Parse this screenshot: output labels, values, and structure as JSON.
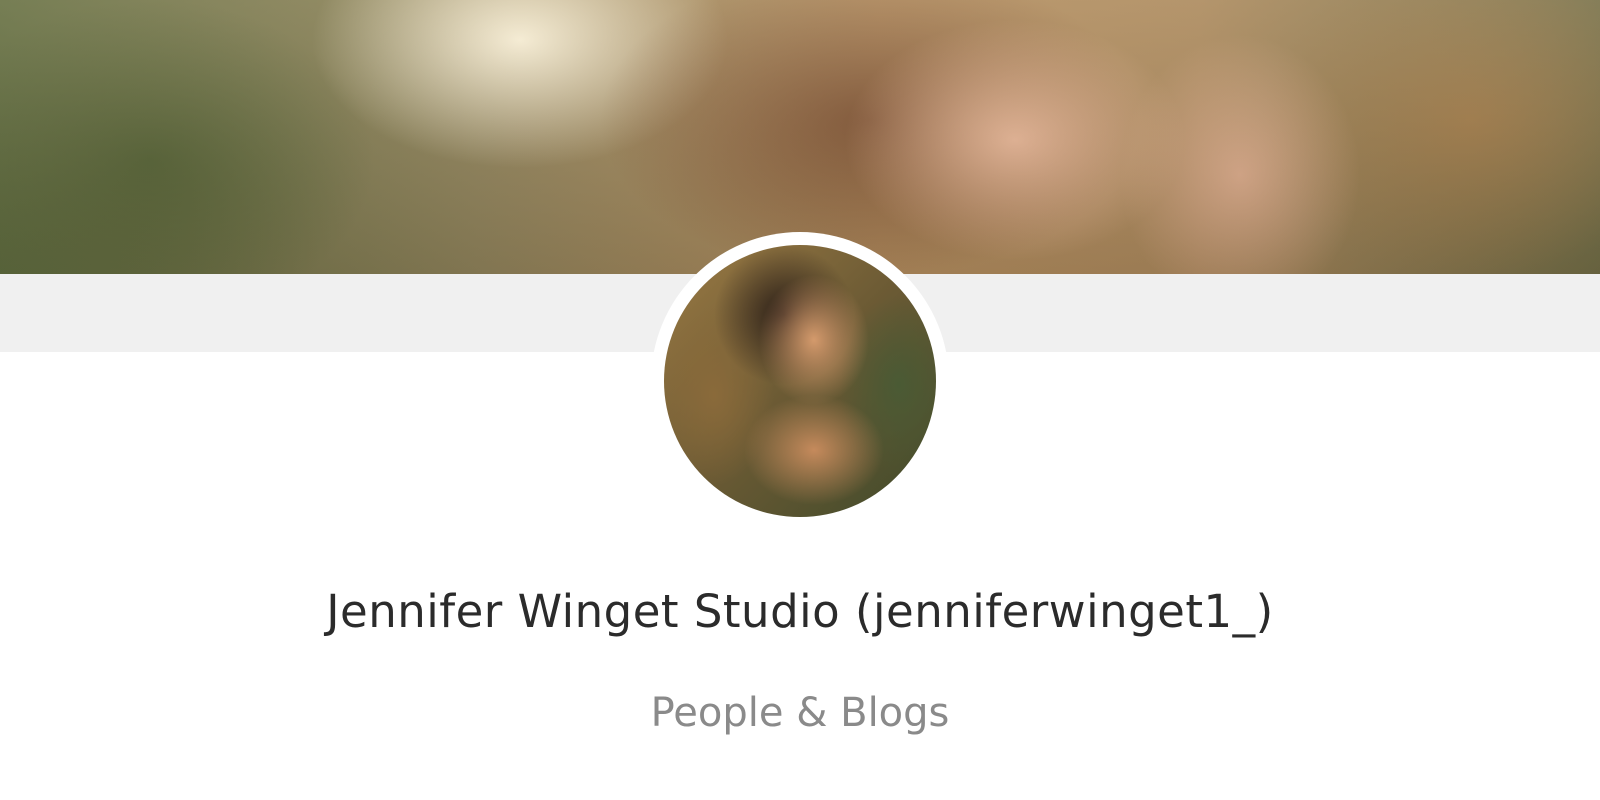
{
  "profile": {
    "name": "Jennifer Winget Studio (jenniferwinget1_)",
    "category": "People & Blogs"
  },
  "images": {
    "cover": "cover-photo",
    "avatar": "profile-avatar"
  }
}
